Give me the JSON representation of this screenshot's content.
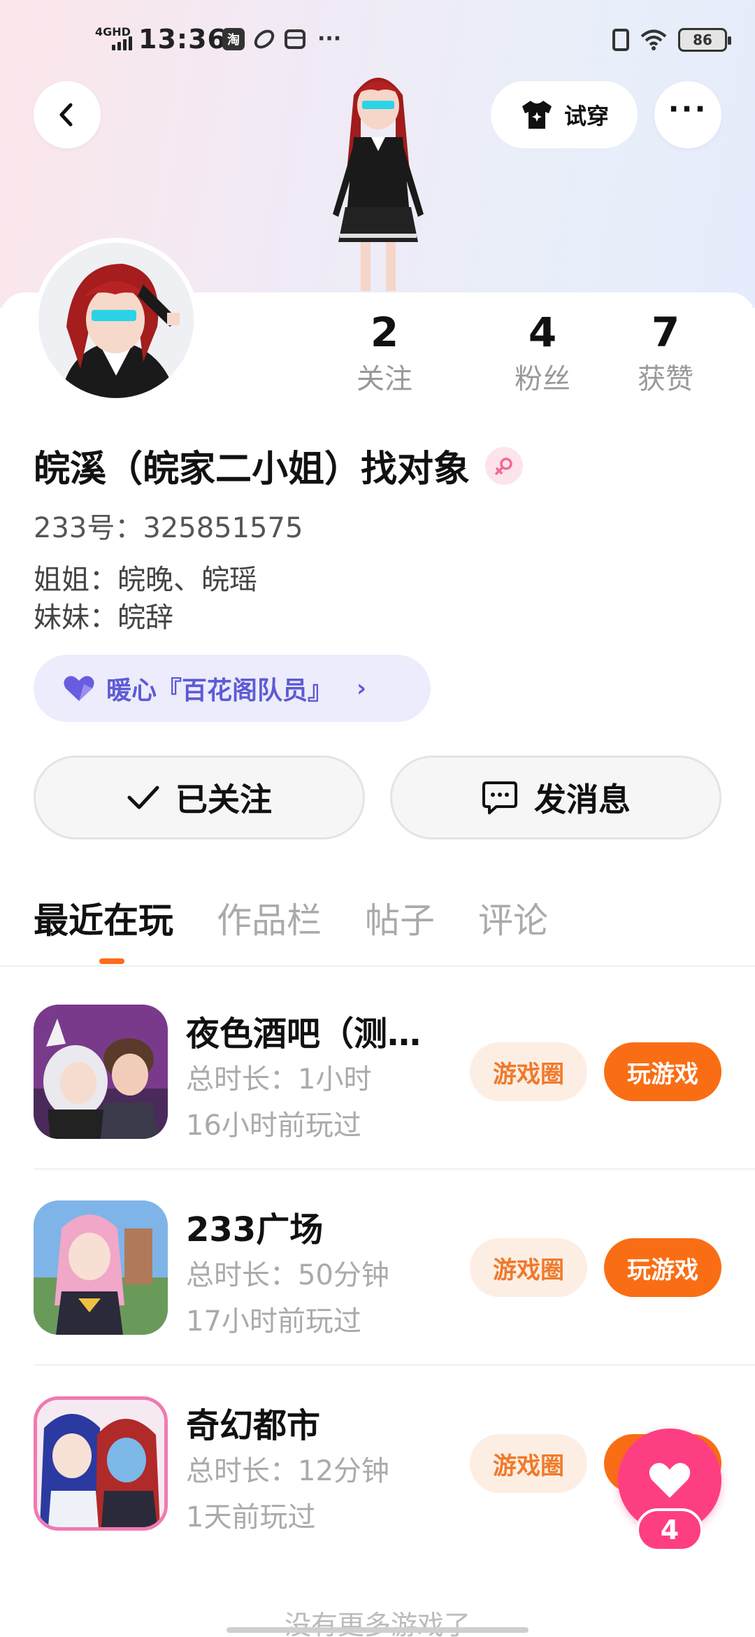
{
  "status_bar": {
    "network": "4GHD",
    "time": "13:36",
    "app_icons": [
      "淘",
      "",
      ""
    ],
    "more": "···",
    "battery": "86"
  },
  "header": {
    "tryon_label": "试穿"
  },
  "profile": {
    "stats": [
      {
        "value": "2",
        "label": "关注"
      },
      {
        "value": "4",
        "label": "粉丝"
      },
      {
        "value": "7",
        "label": "获赞"
      }
    ],
    "nickname": "皖溪（皖家二小姐）找对象",
    "gender": "female",
    "uid": "233号：325851575",
    "bio_lines": [
      "姐姐：皖晚、皖瑶",
      "妹妹：皖辞"
    ],
    "badge_label": "暖心『百花阁队员』"
  },
  "actions": {
    "follow_label": "已关注",
    "message_label": "发消息"
  },
  "tabs": [
    "最近在玩",
    "作品栏",
    "帖子",
    "评论"
  ],
  "games": [
    {
      "title": "夜色酒吧（测…",
      "duration": "总时长：1小时",
      "last_played": "16小时前玩过",
      "circle_label": "游戏圈",
      "play_label": "玩游戏"
    },
    {
      "title": "233广场",
      "duration": "总时长：50分钟",
      "last_played": "17小时前玩过",
      "circle_label": "游戏圈",
      "play_label": "玩游戏"
    },
    {
      "title": "奇幻都市",
      "duration": "总时长：12分钟",
      "last_played": "1天前玩过",
      "circle_label": "游戏圈",
      "play_label": "玩游戏"
    }
  ],
  "like_float": {
    "count": "4"
  },
  "footer": {
    "no_more": "没有更多游戏了"
  },
  "colors": {
    "accent": "#f96e14",
    "like": "#fe3e82",
    "badge_bg": "#ececfc",
    "badge_text": "#5e5bd4"
  }
}
